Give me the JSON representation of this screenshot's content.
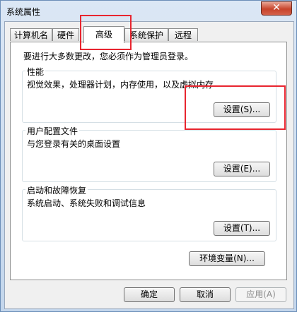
{
  "window": {
    "title": "系统属性",
    "close_glyph": "✕"
  },
  "tabs": [
    {
      "label": "计算机名",
      "active": false
    },
    {
      "label": "硬件",
      "active": false
    },
    {
      "label": "高级",
      "active": true
    },
    {
      "label": "系统保护",
      "active": false
    },
    {
      "label": "远程",
      "active": false
    }
  ],
  "advanced": {
    "admin_note": "要进行大多数更改，您必须作为管理员登录。",
    "performance": {
      "title": "性能",
      "desc": "视觉效果，处理器计划，内存使用，以及虚拟内存",
      "button": "设置(S)..."
    },
    "user_profiles": {
      "title": "用户配置文件",
      "desc": "与您登录有关的桌面设置",
      "button": "设置(E)..."
    },
    "startup_recovery": {
      "title": "启动和故障恢复",
      "desc": "系统启动、系统失败和调试信息",
      "button": "设置(T)..."
    },
    "env_button": "环境变量(N)..."
  },
  "footer": {
    "ok": "确定",
    "cancel": "取消",
    "apply": "应用(A)"
  },
  "colors": {
    "highlight": "#e8252f"
  }
}
